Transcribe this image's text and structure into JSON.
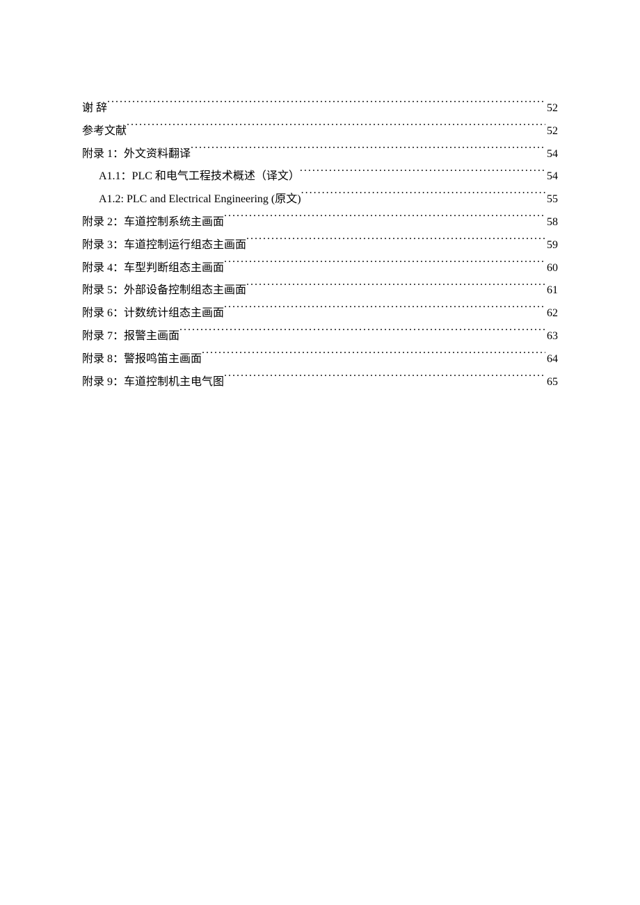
{
  "toc": [
    {
      "level": 1,
      "title": "谢 辞 ",
      "page": "52"
    },
    {
      "level": 1,
      "title": "参考文献 ",
      "page": "52"
    },
    {
      "level": 1,
      "title": "附录 1：外文资料翻译 ",
      "page": "54"
    },
    {
      "level": 2,
      "title": "A1.1：PLC 和电气工程技术概述（译文） ",
      "page": "54"
    },
    {
      "level": 2,
      "title": "A1.2:   PLC and Electrical Engineering (原文)",
      "page": "55"
    },
    {
      "level": 1,
      "title": "附录 2：车道控制系统主画面 ",
      "page": "58"
    },
    {
      "level": 1,
      "title": "附录 3：车道控制运行组态主画面 ",
      "page": "59"
    },
    {
      "level": 1,
      "title": "附录 4：车型判断组态主画面 ",
      "page": "60"
    },
    {
      "level": 1,
      "title": "附录 5：外部设备控制组态主画面 ",
      "page": "61"
    },
    {
      "level": 1,
      "title": "附录 6：计数统计组态主画面 ",
      "page": "62"
    },
    {
      "level": 1,
      "title": "附录 7：报警主画面 ",
      "page": "63"
    },
    {
      "level": 1,
      "title": "附录 8：警报鸣笛主画面 ",
      "page": "64"
    },
    {
      "level": 1,
      "title": "附录 9：车道控制机主电气图 ",
      "page": "65"
    }
  ]
}
